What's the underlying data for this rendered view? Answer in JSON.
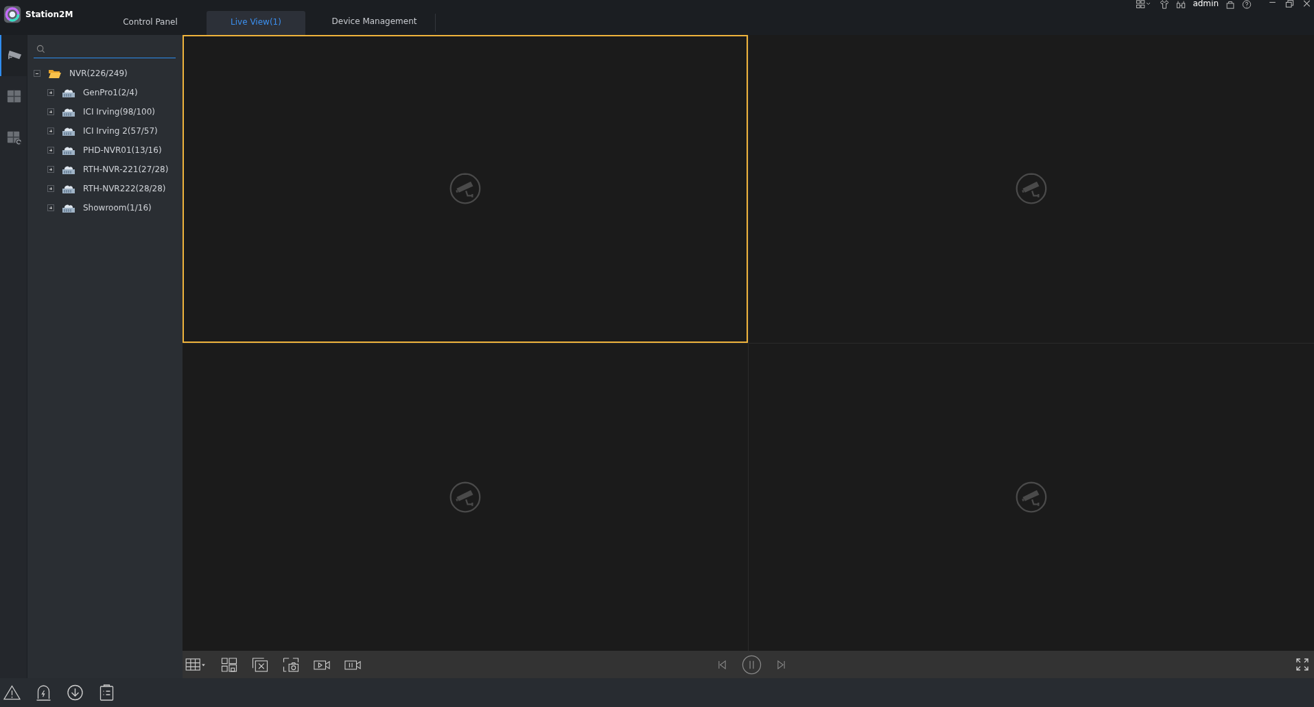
{
  "app": {
    "title": "Station2M"
  },
  "tabs": [
    {
      "label": "Control Panel",
      "selected": false
    },
    {
      "label": "Live View(1)",
      "selected": true
    },
    {
      "label": "Device Management",
      "selected": false
    }
  ],
  "header": {
    "user": "admin"
  },
  "rail": [
    {
      "kind": "live",
      "selected": true
    },
    {
      "kind": "layout",
      "selected": false
    },
    {
      "kind": "playback",
      "selected": false
    }
  ],
  "tree": [
    {
      "label": "NVR(226/249)",
      "kind": "folder",
      "expanded": true,
      "children": [
        {
          "label": "GenPro1(2/4)",
          "kind": "device",
          "expanded": false
        },
        {
          "label": "ICI Irving(98/100)",
          "kind": "device",
          "expanded": false
        },
        {
          "label": "ICI Irving 2(57/57)",
          "kind": "device",
          "expanded": false
        },
        {
          "label": "PHD-NVR01(13/16)",
          "kind": "device",
          "expanded": false
        },
        {
          "label": "RTH-NVR-221(27/28)",
          "kind": "device",
          "expanded": false
        },
        {
          "label": "RTH-NVR222(28/28)",
          "kind": "device",
          "expanded": false
        },
        {
          "label": "Showroom(1/16)",
          "kind": "device",
          "expanded": false
        }
      ]
    }
  ],
  "video_tiles": [
    {
      "selected": true
    },
    {
      "selected": false
    },
    {
      "selected": false
    },
    {
      "selected": false
    }
  ]
}
